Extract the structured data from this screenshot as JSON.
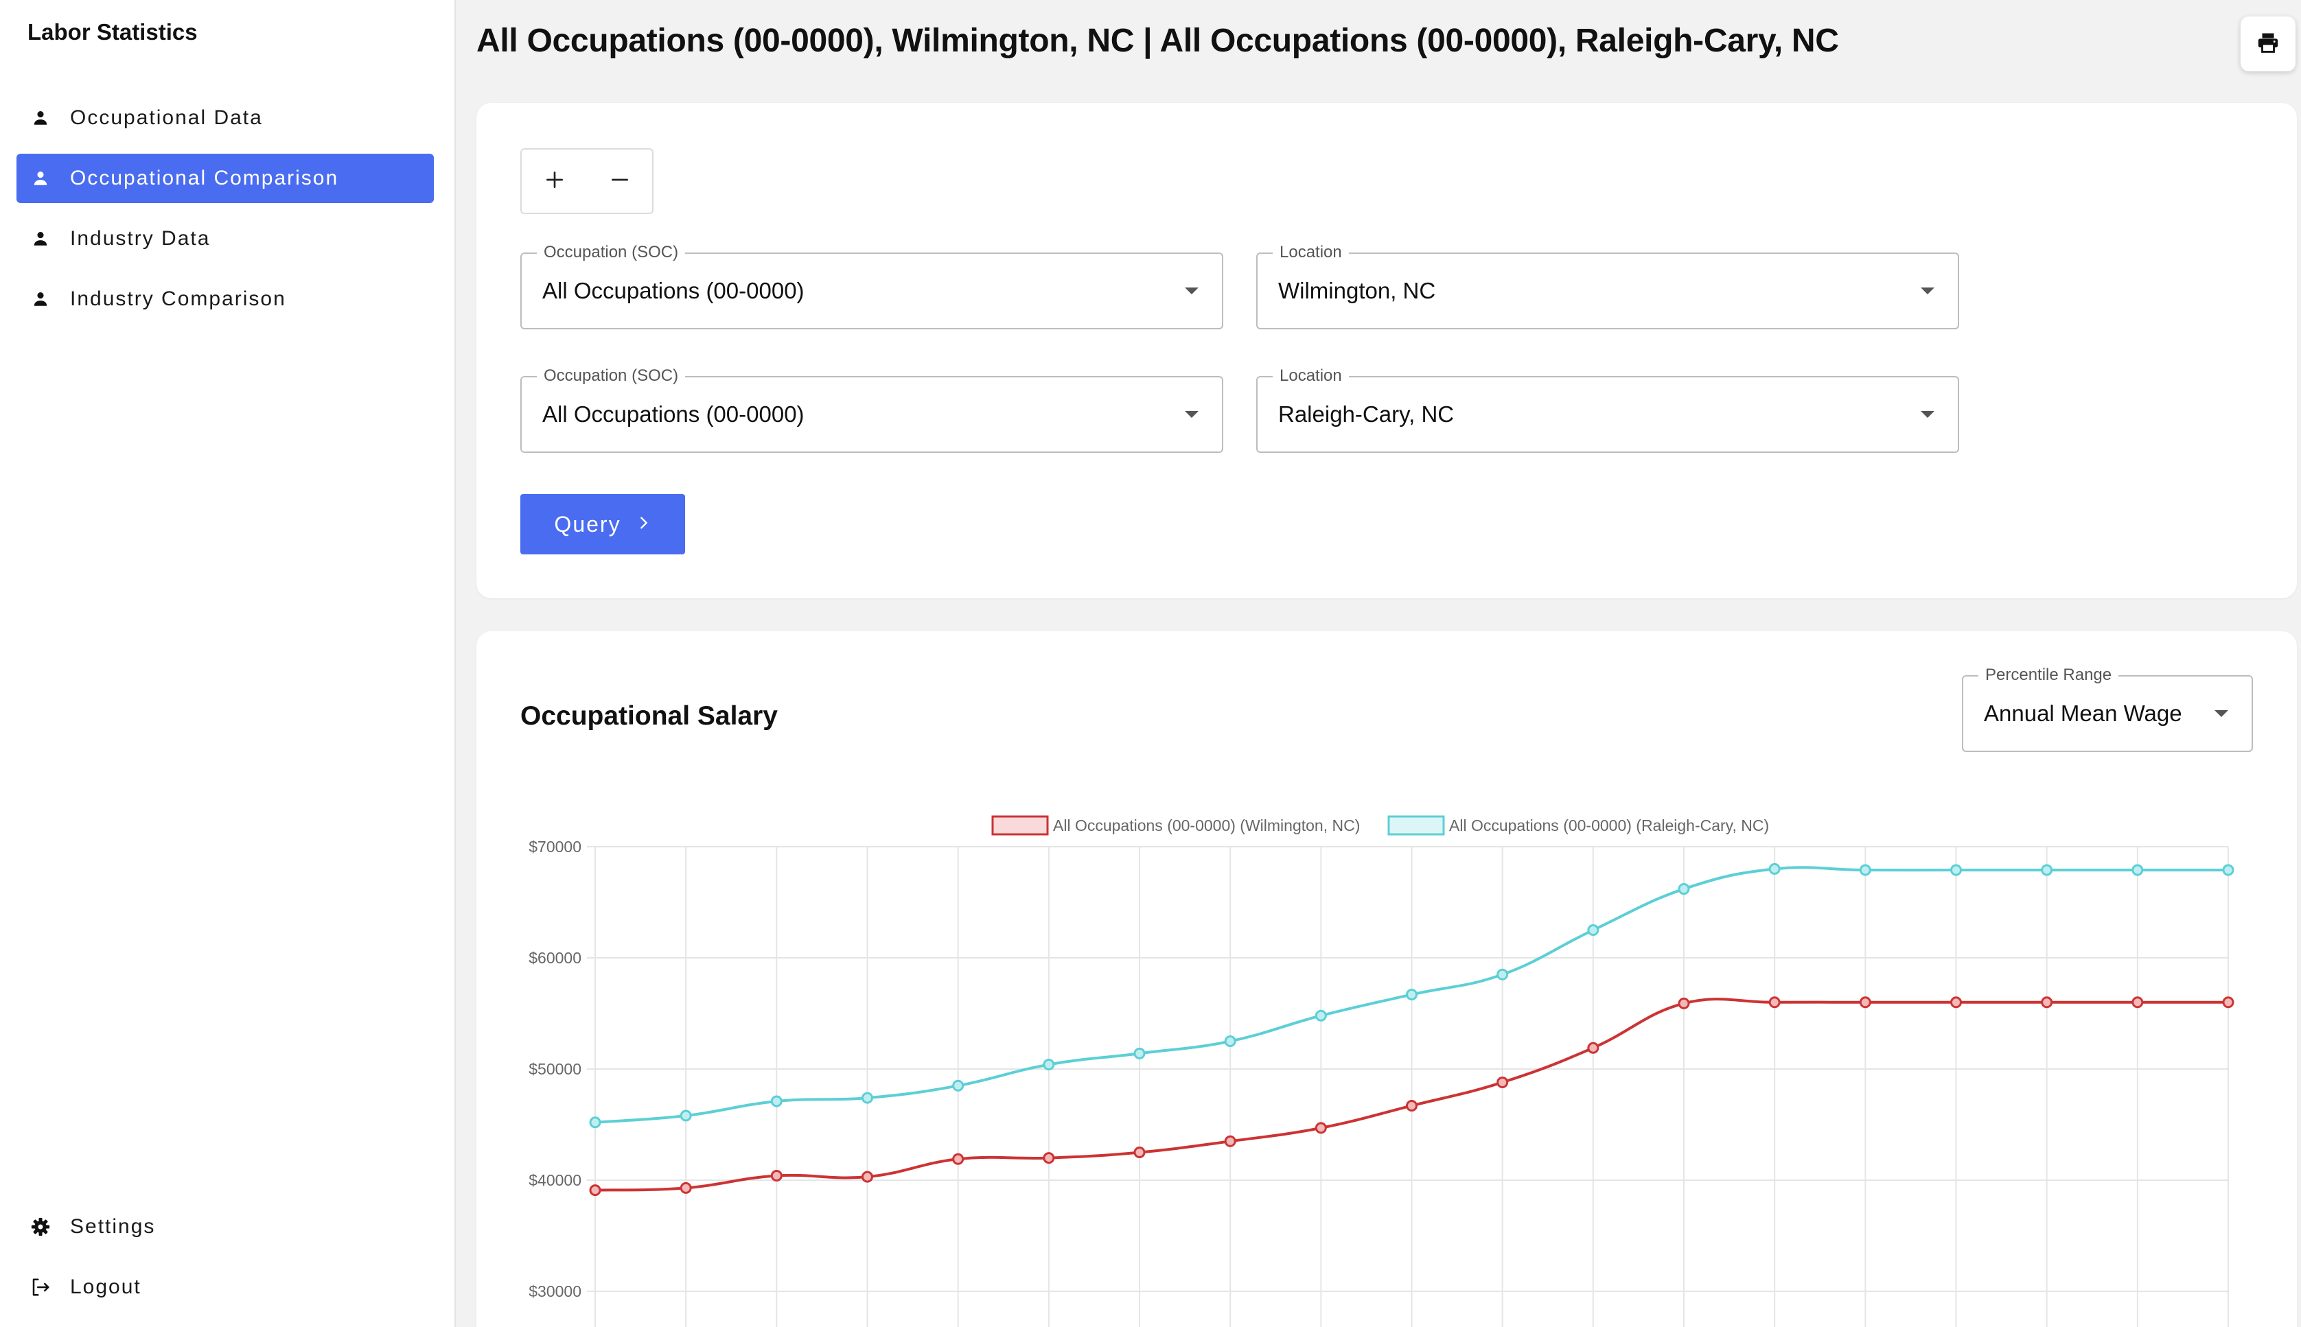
{
  "app": {
    "title": "Labor Statistics"
  },
  "sidebar": {
    "items": [
      {
        "label": "Occupational Data",
        "icon": "person-icon",
        "active": false
      },
      {
        "label": "Occupational Comparison",
        "icon": "person-icon",
        "active": true
      },
      {
        "label": "Industry Data",
        "icon": "person-icon",
        "active": false
      },
      {
        "label": "Industry Comparison",
        "icon": "person-icon",
        "active": false
      }
    ],
    "bottom": [
      {
        "label": "Settings",
        "icon": "gear-icon"
      },
      {
        "label": "Logout",
        "icon": "logout-icon"
      }
    ]
  },
  "header": {
    "title": "All Occupations (00-0000), Wilmington, NC | All Occupations (00-0000), Raleigh-Cary, NC",
    "print_icon": "printer-icon"
  },
  "query_form": {
    "rows": [
      {
        "occupation_label": "Occupation (SOC)",
        "occupation_value": "All Occupations (00-0000)",
        "location_label": "Location",
        "location_value": "Wilmington, NC"
      },
      {
        "occupation_label": "Occupation (SOC)",
        "occupation_value": "All Occupations (00-0000)",
        "location_label": "Location",
        "location_value": "Raleigh-Cary, NC"
      }
    ],
    "add_icon": "plus-icon",
    "remove_icon": "minus-icon",
    "query_label": "Query",
    "query_icon": "chevron-right-icon"
  },
  "salary": {
    "title": "Occupational Salary",
    "percentile_label": "Percentile Range",
    "percentile_value": "Annual Mean Wage"
  },
  "colors": {
    "accent": "#4a6cf0",
    "series_wilmington": "#cc3333",
    "series_raleigh": "#5ccfd6"
  },
  "chart_data": {
    "type": "line",
    "title": "",
    "xlabel": "",
    "ylabel": "",
    "ylim": [
      30000,
      70000
    ],
    "yticks": [
      "$70000",
      "$60000",
      "$50000",
      "$40000",
      "$30000"
    ],
    "grid": true,
    "legend_position": "top",
    "point_count": 19,
    "series": [
      {
        "name": "All Occupations (00-0000) (Wilmington, NC)",
        "color": "#cc3333",
        "values": [
          39100,
          39300,
          40400,
          40300,
          41900,
          42000,
          42500,
          43500,
          44700,
          46700,
          48800,
          51900,
          55900,
          56000,
          56000,
          56000,
          56000,
          56000,
          56000
        ]
      },
      {
        "name": "All Occupations (00-0000) (Raleigh-Cary, NC)",
        "color": "#5ccfd6",
        "values": [
          45200,
          45800,
          47100,
          47400,
          48500,
          50400,
          51400,
          52500,
          54800,
          56700,
          58500,
          62500,
          66200,
          68000,
          67900,
          67900,
          67900,
          67900,
          67900
        ]
      }
    ]
  }
}
